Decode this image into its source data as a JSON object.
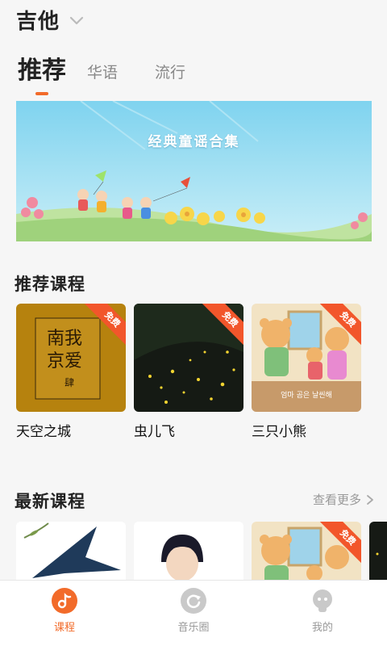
{
  "header": {
    "instrument": "吉他",
    "tabs": [
      {
        "label": "推荐",
        "active": true
      },
      {
        "label": "华语",
        "active": false
      },
      {
        "label": "流行",
        "active": false
      }
    ]
  },
  "banner": {
    "title": "经典童谣合集"
  },
  "recommended": {
    "title": "推荐课程",
    "free_badge": "免费",
    "courses": [
      {
        "label": "天空之城",
        "free": true,
        "cover_text": [
          "南我",
          "京爱"
        ],
        "cover_sub": "肆"
      },
      {
        "label": "虫儿飞",
        "free": true
      },
      {
        "label": "三只小熊",
        "free": true,
        "cover_caption": "엄마 곰은 날씬해"
      }
    ]
  },
  "latest": {
    "title": "最新课程",
    "more_label": "查看更多",
    "free_badge": "免费"
  },
  "tabbar": [
    {
      "label": "课程",
      "icon": "music-note-icon",
      "active": true
    },
    {
      "label": "音乐圈",
      "icon": "refresh-circle-icon",
      "active": false
    },
    {
      "label": "我的",
      "icon": "user-icon",
      "active": false
    }
  ],
  "colors": {
    "accent": "#f26b2a",
    "badge": "#f2562b"
  }
}
